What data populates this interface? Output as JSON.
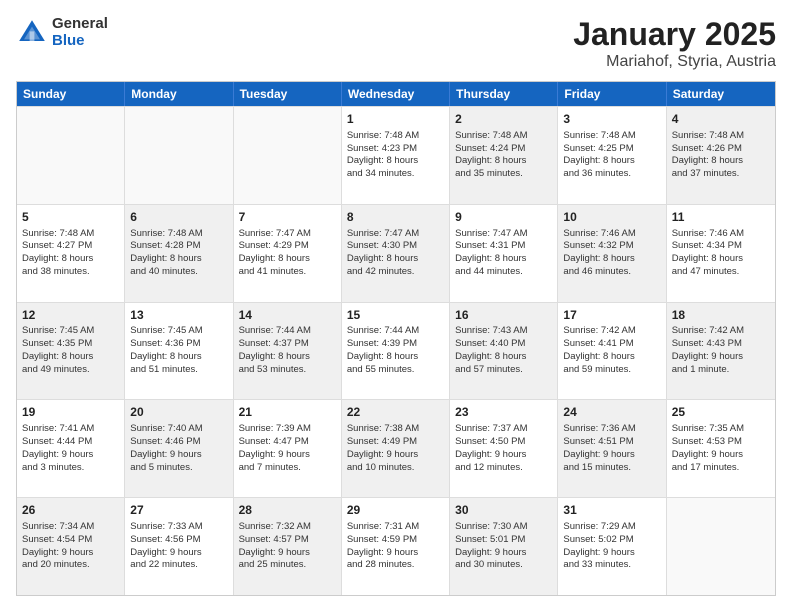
{
  "logo": {
    "general": "General",
    "blue": "Blue"
  },
  "title": {
    "month": "January 2025",
    "location": "Mariahof, Styria, Austria"
  },
  "headers": [
    "Sunday",
    "Monday",
    "Tuesday",
    "Wednesday",
    "Thursday",
    "Friday",
    "Saturday"
  ],
  "weeks": [
    [
      {
        "day": "",
        "info": "",
        "bg": "empty"
      },
      {
        "day": "",
        "info": "",
        "bg": "empty"
      },
      {
        "day": "",
        "info": "",
        "bg": "empty"
      },
      {
        "day": "1",
        "info": "Sunrise: 7:48 AM\nSunset: 4:23 PM\nDaylight: 8 hours\nand 34 minutes.",
        "bg": ""
      },
      {
        "day": "2",
        "info": "Sunrise: 7:48 AM\nSunset: 4:24 PM\nDaylight: 8 hours\nand 35 minutes.",
        "bg": "alt-bg"
      },
      {
        "day": "3",
        "info": "Sunrise: 7:48 AM\nSunset: 4:25 PM\nDaylight: 8 hours\nand 36 minutes.",
        "bg": ""
      },
      {
        "day": "4",
        "info": "Sunrise: 7:48 AM\nSunset: 4:26 PM\nDaylight: 8 hours\nand 37 minutes.",
        "bg": "alt-bg"
      }
    ],
    [
      {
        "day": "5",
        "info": "Sunrise: 7:48 AM\nSunset: 4:27 PM\nDaylight: 8 hours\nand 38 minutes.",
        "bg": ""
      },
      {
        "day": "6",
        "info": "Sunrise: 7:48 AM\nSunset: 4:28 PM\nDaylight: 8 hours\nand 40 minutes.",
        "bg": "alt-bg"
      },
      {
        "day": "7",
        "info": "Sunrise: 7:47 AM\nSunset: 4:29 PM\nDaylight: 8 hours\nand 41 minutes.",
        "bg": ""
      },
      {
        "day": "8",
        "info": "Sunrise: 7:47 AM\nSunset: 4:30 PM\nDaylight: 8 hours\nand 42 minutes.",
        "bg": "alt-bg"
      },
      {
        "day": "9",
        "info": "Sunrise: 7:47 AM\nSunset: 4:31 PM\nDaylight: 8 hours\nand 44 minutes.",
        "bg": ""
      },
      {
        "day": "10",
        "info": "Sunrise: 7:46 AM\nSunset: 4:32 PM\nDaylight: 8 hours\nand 46 minutes.",
        "bg": "alt-bg"
      },
      {
        "day": "11",
        "info": "Sunrise: 7:46 AM\nSunset: 4:34 PM\nDaylight: 8 hours\nand 47 minutes.",
        "bg": ""
      }
    ],
    [
      {
        "day": "12",
        "info": "Sunrise: 7:45 AM\nSunset: 4:35 PM\nDaylight: 8 hours\nand 49 minutes.",
        "bg": "alt-bg"
      },
      {
        "day": "13",
        "info": "Sunrise: 7:45 AM\nSunset: 4:36 PM\nDaylight: 8 hours\nand 51 minutes.",
        "bg": ""
      },
      {
        "day": "14",
        "info": "Sunrise: 7:44 AM\nSunset: 4:37 PM\nDaylight: 8 hours\nand 53 minutes.",
        "bg": "alt-bg"
      },
      {
        "day": "15",
        "info": "Sunrise: 7:44 AM\nSunset: 4:39 PM\nDaylight: 8 hours\nand 55 minutes.",
        "bg": ""
      },
      {
        "day": "16",
        "info": "Sunrise: 7:43 AM\nSunset: 4:40 PM\nDaylight: 8 hours\nand 57 minutes.",
        "bg": "alt-bg"
      },
      {
        "day": "17",
        "info": "Sunrise: 7:42 AM\nSunset: 4:41 PM\nDaylight: 8 hours\nand 59 minutes.",
        "bg": ""
      },
      {
        "day": "18",
        "info": "Sunrise: 7:42 AM\nSunset: 4:43 PM\nDaylight: 9 hours\nand 1 minute.",
        "bg": "alt-bg"
      }
    ],
    [
      {
        "day": "19",
        "info": "Sunrise: 7:41 AM\nSunset: 4:44 PM\nDaylight: 9 hours\nand 3 minutes.",
        "bg": ""
      },
      {
        "day": "20",
        "info": "Sunrise: 7:40 AM\nSunset: 4:46 PM\nDaylight: 9 hours\nand 5 minutes.",
        "bg": "alt-bg"
      },
      {
        "day": "21",
        "info": "Sunrise: 7:39 AM\nSunset: 4:47 PM\nDaylight: 9 hours\nand 7 minutes.",
        "bg": ""
      },
      {
        "day": "22",
        "info": "Sunrise: 7:38 AM\nSunset: 4:49 PM\nDaylight: 9 hours\nand 10 minutes.",
        "bg": "alt-bg"
      },
      {
        "day": "23",
        "info": "Sunrise: 7:37 AM\nSunset: 4:50 PM\nDaylight: 9 hours\nand 12 minutes.",
        "bg": ""
      },
      {
        "day": "24",
        "info": "Sunrise: 7:36 AM\nSunset: 4:51 PM\nDaylight: 9 hours\nand 15 minutes.",
        "bg": "alt-bg"
      },
      {
        "day": "25",
        "info": "Sunrise: 7:35 AM\nSunset: 4:53 PM\nDaylight: 9 hours\nand 17 minutes.",
        "bg": ""
      }
    ],
    [
      {
        "day": "26",
        "info": "Sunrise: 7:34 AM\nSunset: 4:54 PM\nDaylight: 9 hours\nand 20 minutes.",
        "bg": "alt-bg"
      },
      {
        "day": "27",
        "info": "Sunrise: 7:33 AM\nSunset: 4:56 PM\nDaylight: 9 hours\nand 22 minutes.",
        "bg": ""
      },
      {
        "day": "28",
        "info": "Sunrise: 7:32 AM\nSunset: 4:57 PM\nDaylight: 9 hours\nand 25 minutes.",
        "bg": "alt-bg"
      },
      {
        "day": "29",
        "info": "Sunrise: 7:31 AM\nSunset: 4:59 PM\nDaylight: 9 hours\nand 28 minutes.",
        "bg": ""
      },
      {
        "day": "30",
        "info": "Sunrise: 7:30 AM\nSunset: 5:01 PM\nDaylight: 9 hours\nand 30 minutes.",
        "bg": "alt-bg"
      },
      {
        "day": "31",
        "info": "Sunrise: 7:29 AM\nSunset: 5:02 PM\nDaylight: 9 hours\nand 33 minutes.",
        "bg": ""
      },
      {
        "day": "",
        "info": "",
        "bg": "empty"
      }
    ]
  ]
}
